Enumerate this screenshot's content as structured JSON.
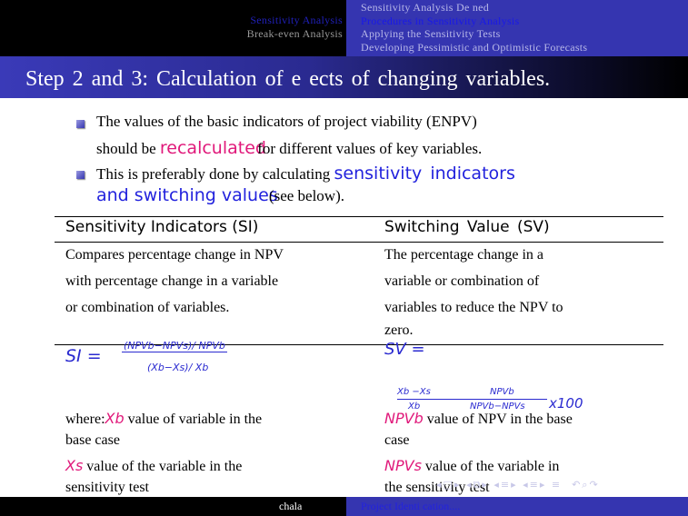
{
  "header": {
    "left_sections": [
      {
        "label": "Sensitivity Analysis",
        "active": true
      },
      {
        "label": "Break-even Analysis",
        "active": false
      }
    ],
    "right_subsections": [
      {
        "label": "Sensitivity Analysis De ned",
        "active": false
      },
      {
        "label": "Procedures  in  Sensitivity  Analysis",
        "active": true
      },
      {
        "label": "Applying  the  Sensitivity  Tests",
        "active": false
      },
      {
        "label": "Developing  Pessimistic  and  Optimistic  Forecasts",
        "active": false
      }
    ]
  },
  "title": "Step  2  and  3:  Calculation  of  e ects  of  changing  variables.",
  "bullets": [
    {
      "line1": "The values of the basic indicators of project viability (ENPV)",
      "line2_pre": "should be ",
      "highlight": "recalculated",
      "line2_post": " for different values of  key  variables."
    },
    {
      "line1_pre": "This is preferably done by  calculating ",
      "highlight1": "sensitivity  indicators",
      "highlight2": "and switching values",
      "post": " (see below)."
    }
  ],
  "table": {
    "headers": [
      "Sensitivity Indicators (SI)",
      "Switching  Value  (SV)"
    ],
    "left_desc": [
      "Compares percentage change in NPV",
      "with percentage  change in a variable",
      "or combination of variables."
    ],
    "right_desc": [
      "The  percentage  change  in  a",
      "variable or combination of",
      "variables to reduce the NPV to",
      "zero."
    ],
    "si_formula": {
      "lhs": "SI  =",
      "num": "(NPVb−NPVs)/ NPVb",
      "den": "(Xb−Xs)/ Xb"
    },
    "sv_formula": {
      "lhs": "SV  =",
      "f1_num": "Xb −Xs",
      "f1_den": "Xb",
      "f2_num": "NPVb",
      "f2_den": "NPVb−NPVs",
      "mult": "x100"
    },
    "left_where": {
      "prefix": "where:",
      "sym1": "Xb",
      "text1a": " value of variable in the",
      "text1b": "base case",
      "sym2": "Xs",
      "text2a": "  value of the variable in the",
      "text2b": "sensitivity test"
    },
    "right_where": {
      "sym1": "NPVb",
      "text1a": "  value of NPV in the base",
      "text1b": "case",
      "sym2": "NPVs",
      "text2a": " value of the variable in",
      "text2b": "the sensitivity test"
    }
  },
  "footer": {
    "author": "chala",
    "short_title": "Project Identi cation...."
  },
  "colors": {
    "header_blue": "#3535b0",
    "highlight_pink": "#e0187a",
    "highlight_blue": "#2222dd"
  }
}
